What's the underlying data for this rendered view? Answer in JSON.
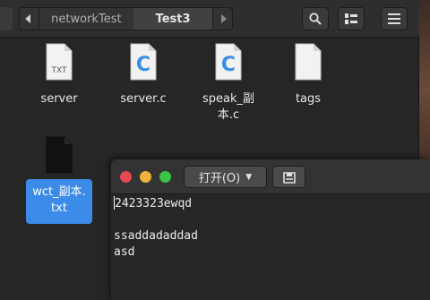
{
  "file_manager": {
    "path": [
      "networkTest",
      "Test3"
    ],
    "files": [
      {
        "name": "server",
        "icon": "txt-file-icon",
        "type_label": "TXT"
      },
      {
        "name": "server.c",
        "icon": "c-source-file-icon",
        "type_label": "C"
      },
      {
        "name": "speak_副本.c",
        "name_line1": "speak_副",
        "name_line2": "本.c",
        "icon": "c-source-file-icon",
        "type_label": "C"
      },
      {
        "name": "tags",
        "icon": "file-icon"
      },
      {
        "name": "wct_副本.txt",
        "name_line1": "wct_副本.",
        "name_line2": "txt",
        "icon": "dark-file-icon",
        "selected": true
      }
    ]
  },
  "editor": {
    "open_label": "打开(O)",
    "lines": [
      "2423323ewqd",
      "",
      "ssaddadaddad",
      "asd"
    ]
  },
  "colors": {
    "selection": "#3d8be8",
    "close": "#e6484f",
    "minimize": "#f0b23b",
    "maximize": "#3cc44a",
    "c_icon": "#3a8ee6"
  }
}
